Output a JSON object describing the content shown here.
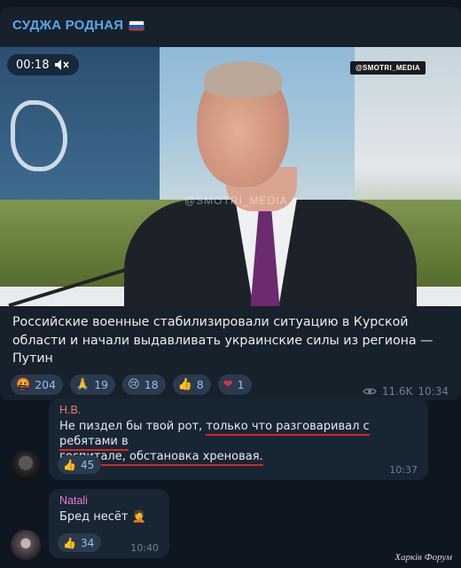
{
  "channel": {
    "title": "СУДЖА РОДНАЯ",
    "flag_icon": "russia-flag-icon"
  },
  "video": {
    "duration": "00:18",
    "volume_icon": "speaker-icon",
    "watermark_badge": "@SMOTRI_MEDIA",
    "watermark_center": "@SMOTRI_MEDIA"
  },
  "post": {
    "text": "Российские военные стабилизировали ситуацию в Курской области и начали выдавливать украинские силы из региона — Путин",
    "reactions": [
      {
        "emoji": "🤬",
        "count": "204"
      },
      {
        "emoji": "🙏",
        "count": "19"
      },
      {
        "emoji": "😢",
        "count": "18"
      },
      {
        "emoji": "👍",
        "count": "8"
      },
      {
        "emoji": "❤",
        "count": "1"
      }
    ],
    "views": "11.6K",
    "time": "10:34"
  },
  "comments": [
    {
      "author": "Н.В.",
      "author_color": "#f07a6a",
      "text_plain": "Не пиздел бы твой рот, ",
      "text_underlined_1": "только что разговаривал с ребятами в",
      "text_underlined_2": "госпитале, обстановка хреновая.",
      "reaction_emoji": "👍",
      "reaction_count": "45",
      "time": "10:37"
    },
    {
      "author": "Natali",
      "author_color": "#e57bd1",
      "text": "Бред несёт",
      "text_emoji": "🤦",
      "reaction_emoji": "👍",
      "reaction_count": "34",
      "time": "10:40"
    }
  ],
  "footer": {
    "label": "Харків Форум"
  }
}
